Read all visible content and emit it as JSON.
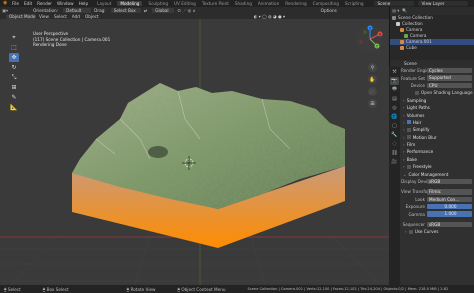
{
  "topbar": {
    "menus": [
      "File",
      "Edit",
      "Render",
      "Window",
      "Help"
    ],
    "workspaces": [
      "Layout",
      "Modeling",
      "Sculpting",
      "UV Editing",
      "Texture Paint",
      "Shading",
      "Animation",
      "Rendering",
      "Compositing",
      "Scripting"
    ],
    "active_workspace": "Modeling",
    "scene": "Scene",
    "view_layer": "View Layer"
  },
  "header3d": {
    "row1": [
      "Orientation:",
      "Default",
      "Drag:",
      "Select Box",
      "Global"
    ],
    "row2": [
      "Object Mode",
      "View",
      "Select",
      "Add",
      "Object"
    ],
    "options": "Options"
  },
  "viewport": {
    "info": [
      "User Perspective",
      "(117) Scene Collection | Camera.001",
      "Rendering Done"
    ],
    "terrain_colors": {
      "top": "#7d9a66",
      "side_top": "#c99a7a",
      "side_bottom": "#ff8c00"
    },
    "gizmo_labels": [
      "Y",
      "X",
      "Z"
    ]
  },
  "toolbar": {
    "tools": [
      "cursor-icon",
      "select-icon",
      "move-icon",
      "rotate-icon",
      "scale-icon",
      "transform-icon",
      "annotate-icon",
      "measure-icon"
    ]
  },
  "outliner": {
    "items": [
      "Scene Collection",
      "Collection",
      "Camera",
      "Camera",
      "Camera.001",
      "Cube"
    ],
    "selected_index": 4
  },
  "properties": {
    "header": "Scene",
    "rows": [
      {
        "label": "Render Engine",
        "value": "Cycles"
      },
      {
        "label": "Feature Set",
        "value": "Supported"
      },
      {
        "label": "Device",
        "value": "CPU"
      }
    ],
    "osl": "Open Shading Language",
    "sections": [
      "Sampling",
      "Light Paths",
      "Volumes",
      "Hair",
      "Simplify",
      "Motion Blur",
      "Film",
      "Performance",
      "Bake",
      "Freestyle",
      "Color Management"
    ],
    "color_mgmt": [
      {
        "label": "Display Device",
        "value": "sRGB"
      },
      {
        "label": "View Transform",
        "value": "Filmic"
      },
      {
        "label": "Look",
        "value": "Medium Con..."
      },
      {
        "label": "Exposure",
        "value": "0.000"
      },
      {
        "label": "Gamma",
        "value": "1.000"
      },
      {
        "label": "Sequencer",
        "value": "sRGB"
      }
    ],
    "use_curves": "Use Curves"
  },
  "statusbar": {
    "select": "Select",
    "box_select": "Box Select",
    "rotate": "Rotate View",
    "context": "Object Context Menu",
    "stats": "Scene Collection | Camera.001 | Verts:12,100 | Faces:12,102 | Tris:24,204 | Objects:0/2 | Mem: 218.0 MiB | 2.82"
  }
}
